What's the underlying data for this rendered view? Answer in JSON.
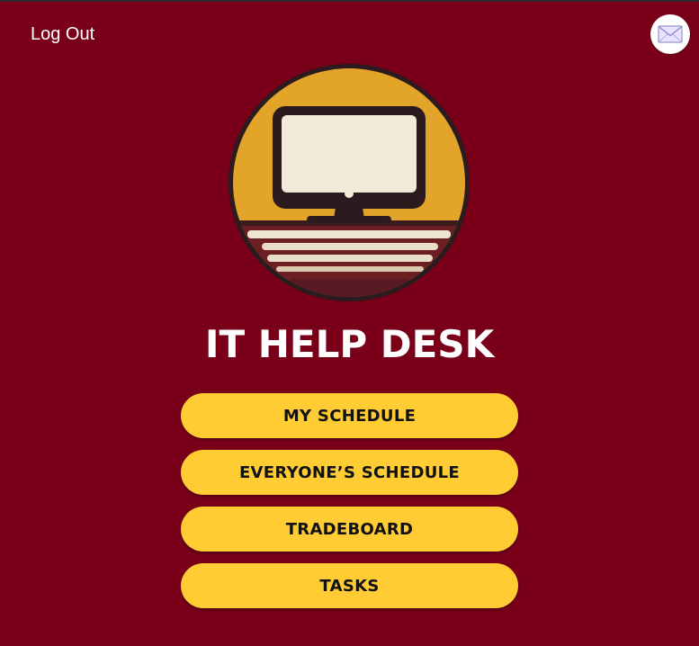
{
  "header": {
    "logout_label": "Log Out",
    "mail_icon": "envelope-icon"
  },
  "app": {
    "title": "IT HELP DESK",
    "logo_icon": "computer-monitor-icon"
  },
  "menu": {
    "items": [
      {
        "label": "MY SCHEDULE"
      },
      {
        "label": "EVERYONE’S SCHEDULE"
      },
      {
        "label": "TRADEBOARD"
      },
      {
        "label": "TASKS"
      }
    ]
  },
  "colors": {
    "background": "#7a0019",
    "button": "#ffcc33",
    "button_text": "#111111",
    "logo_gold": "#e3a42a",
    "logo_ring": "#2b1a1e"
  }
}
